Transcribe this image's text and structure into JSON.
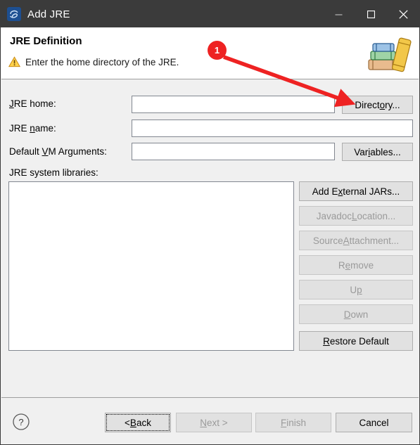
{
  "window": {
    "title": "Add JRE",
    "app_icon": "eclipse-icon",
    "controls": [
      {
        "name": "minimize-button",
        "glyph": "minimize-icon"
      },
      {
        "name": "maximize-button",
        "glyph": "maximize-icon"
      },
      {
        "name": "close-button",
        "glyph": "close-icon"
      }
    ]
  },
  "header": {
    "title": "JRE Definition",
    "status_icon": "warning-icon",
    "description": "Enter the home directory of the JRE.",
    "decoration_icon": "books-icon"
  },
  "form": {
    "jre_home": {
      "label_pre": "",
      "label_mnemonic": "J",
      "label_post": "RE home:",
      "value": "",
      "placeholder": ""
    },
    "jre_name": {
      "label_pre": "JRE ",
      "label_mnemonic": "n",
      "label_post": "ame:",
      "value": "",
      "placeholder": ""
    },
    "vm_args": {
      "label_pre": "Default ",
      "label_mnemonic": "V",
      "label_post": "M Arguments:",
      "value": "",
      "placeholder": ""
    },
    "libraries_label": "JRE system libraries:",
    "library_items": []
  },
  "buttons": {
    "directory": {
      "pre": "Direct",
      "mn": "o",
      "post": "ry...",
      "enabled": true
    },
    "variables": {
      "pre": "Var",
      "mn": "i",
      "post": "ables...",
      "enabled": true
    },
    "add_external_jars": {
      "pre": "Add E",
      "mn": "x",
      "post": "ternal JARs...",
      "enabled": true
    },
    "javadoc_location": {
      "pre": "Javadoc ",
      "mn": "L",
      "post": "ocation...",
      "enabled": false
    },
    "source_attachment": {
      "pre": "Source ",
      "mn": "A",
      "post": "ttachment...",
      "enabled": false
    },
    "remove": {
      "pre": "R",
      "mn": "e",
      "post": "move",
      "enabled": false
    },
    "up": {
      "pre": "U",
      "mn": "p",
      "post": "",
      "enabled": false
    },
    "down": {
      "pre": "",
      "mn": "D",
      "post": "own",
      "enabled": false
    },
    "restore_default": {
      "pre": "",
      "mn": "R",
      "post": "estore Default",
      "enabled": true
    }
  },
  "footer": {
    "help_icon": "help-icon",
    "back": {
      "pre": "< ",
      "mn": "B",
      "post": "ack",
      "enabled": true,
      "focused": true
    },
    "next": {
      "pre": "",
      "mn": "N",
      "post": "ext >",
      "enabled": false,
      "focused": false
    },
    "finish": {
      "pre": "",
      "mn": "F",
      "post": "inish",
      "enabled": false,
      "focused": false
    },
    "cancel": {
      "pre": "Cancel",
      "mn": "",
      "post": "",
      "enabled": true,
      "focused": false
    }
  },
  "annotation": {
    "badge_number": "1",
    "color": "#ee2222",
    "points_to": "directory-button"
  },
  "colors": {
    "titlebar_bg": "#3b3b3b",
    "body_bg": "#f0f0f0",
    "header_bg": "#ffffff",
    "button_bg": "#e1e1e1",
    "annotation_red": "#ee2222",
    "disabled_text": "#9a9a9a"
  }
}
